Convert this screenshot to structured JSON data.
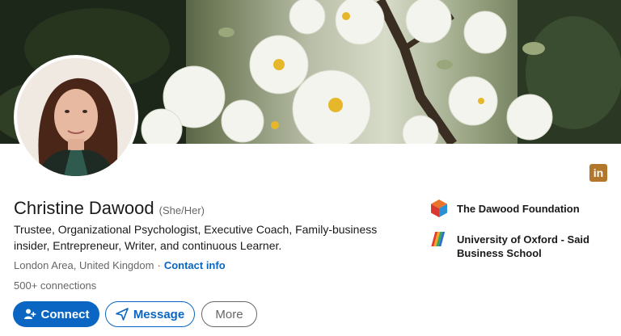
{
  "profile": {
    "name": "Christine Dawood",
    "pronouns": "(She/Her)",
    "headline": "Trustee, Organizational Psychologist, Executive Coach, Family-business insider, Entrepreneur, Writer, and continuous Learner.",
    "location": "London Area, United Kingdom",
    "separator": "·",
    "contact_info": "Contact info",
    "connections": "500+ connections"
  },
  "actions": {
    "connect": "Connect",
    "message": "Message",
    "more": "More"
  },
  "organizations": [
    {
      "name": "The Dawood Foundation",
      "logo": "dawood-foundation-cube-logo"
    },
    {
      "name": "University of Oxford - Said Business School",
      "logo": "oxford-said-logo"
    }
  ],
  "badge": {
    "label": "in",
    "icon": "linkedin-icon"
  },
  "colors": {
    "primary": "#0a66c2",
    "text": "#191919",
    "muted": "#666666",
    "badge": "#b2772a"
  }
}
